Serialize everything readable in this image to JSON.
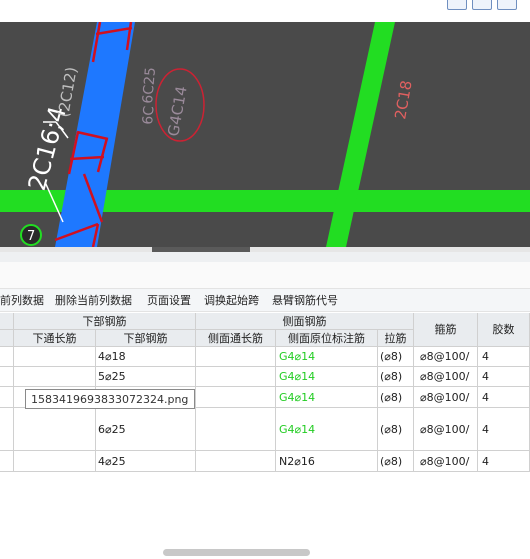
{
  "canvas": {
    "label_rotated_main": "2C16;4",
    "label_rotated_paren": "(2C12)",
    "label_6c": "6C",
    "label_6c25": "6C25",
    "label_g4c14": "G4C14",
    "label_2c18": "2C18",
    "axis_marker": "7"
  },
  "toolbar": {
    "items": [
      "前列数据",
      "删除当前列数据",
      "页面设置",
      "调换起始跨",
      "悬臂钢筋代号"
    ]
  },
  "table": {
    "group_headers": {
      "bottom": "下部钢筋",
      "side": "侧面钢筋"
    },
    "headers": {
      "bottom_through": "下通长筋",
      "bottom_bars": "下部钢筋",
      "side_through": "侧面通长筋",
      "side_inplace": "侧面原位标注筋",
      "tie": "拉筋",
      "stirrup": "箍筋",
      "legs": "胶数"
    },
    "rows": [
      {
        "bottom_bars": "4⌀18",
        "side_inplace": "G4⌀14",
        "tie": "(⌀8)",
        "stirrup": "⌀8@100/",
        "legs": "4"
      },
      {
        "bottom_bars": "5⌀25",
        "side_inplace": "G4⌀14",
        "tie": "(⌀8)",
        "stirrup": "⌀8@100/",
        "legs": "4"
      },
      {
        "bottom_bars": "",
        "side_inplace": "G4⌀14",
        "tie": "(⌀8)",
        "stirrup": "⌀8@100/",
        "legs": "4"
      },
      {
        "bottom_bars": "6⌀25",
        "side_inplace": "G4⌀14",
        "tie": "(⌀8)",
        "stirrup": "⌀8@100/",
        "legs": "4"
      },
      {
        "bottom_bars": "4⌀25",
        "side_inplace": "N2⌀16",
        "tie": "(⌀8)",
        "stirrup": "⌀8@100/",
        "legs": "4"
      }
    ]
  },
  "tooltip": "1583419693833072324.png",
  "colors": {
    "canvas_bg": "#4a4a4a",
    "beam_green": "#22dd22",
    "beam_blue": "#1e78ff",
    "rebar_red": "#d01020",
    "green_text": "#22cc22"
  }
}
